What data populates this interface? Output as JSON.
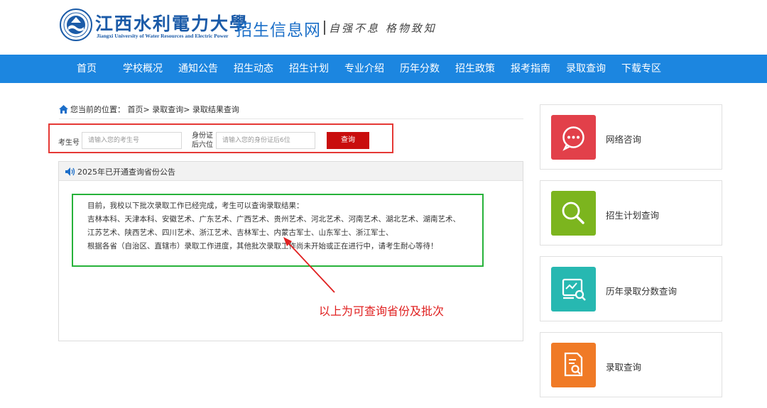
{
  "header": {
    "logo_name": "江西水利電力大學",
    "logo_en": "Jiangxi University of Water Resources and Electric Power",
    "site_name": "招生信息网",
    "motto": "自强不息 格物致知"
  },
  "nav": {
    "items": [
      "首页",
      "学校概况",
      "通知公告",
      "招生动态",
      "招生计划",
      "专业介绍",
      "历年分数",
      "招生政策",
      "报考指南",
      "录取查询",
      "下载专区"
    ]
  },
  "breadcrumb": {
    "prefix": "您当前的位置：",
    "path": "首页> 录取查询> 录取结果查询"
  },
  "query": {
    "exam_label": "考生号",
    "exam_placeholder": "请输入您的考生号",
    "id_label_line1": "身份证",
    "id_label_line2": "后六位",
    "id_placeholder": "请输入您的身份证后6位",
    "submit_label": "查询"
  },
  "notice": {
    "title": "2025年已开通查询省份公告",
    "lines": [
      "目前，我校以下批次录取工作已经完成，考生可以查询录取结果：",
      "吉林本科、天津本科、安徽艺术、广东艺术、广西艺术、贵州艺术、河北艺术、河南艺术、湖北艺术、湖南艺术、",
      "江苏艺术、陕西艺术、四川艺术、浙江艺术、吉林军士、内蒙古军士、山东军士、浙江军士、",
      "根据各省（自治区、直辖市）录取工作进度，其他批次录取工作尚未开始或正在进行中，请考生耐心等待！"
    ],
    "annotation": "以上为可查询省份及批次"
  },
  "sidebar": {
    "items": [
      {
        "label": "网络咨询",
        "icon": "chat-icon",
        "color": "#e2404a"
      },
      {
        "label": "招生计划查询",
        "icon": "search-icon",
        "color": "#7cb51e"
      },
      {
        "label": "历年录取分数查询",
        "icon": "score-report-icon",
        "color": "#27b8b1"
      },
      {
        "label": "录取查询",
        "icon": "document-search-icon",
        "color": "#f07a26"
      }
    ]
  },
  "colors": {
    "nav_bg": "#1c86e0",
    "query_border": "#e53935",
    "notice_border": "#27b23a",
    "button_bg": "#c90d0d",
    "annotation": "#e02020"
  }
}
